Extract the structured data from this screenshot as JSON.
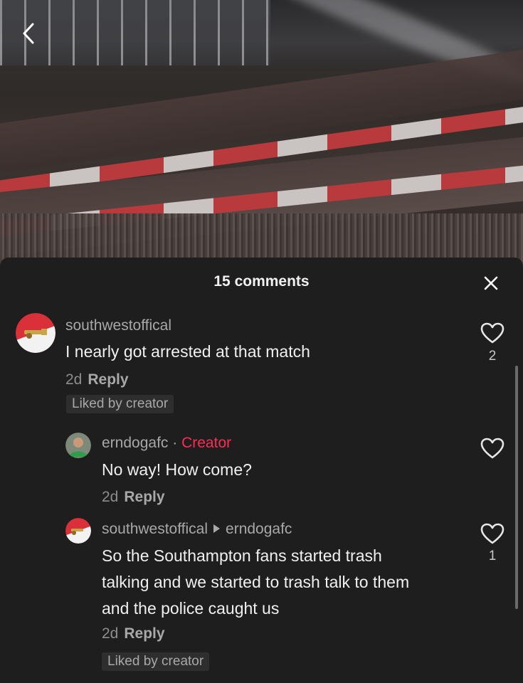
{
  "sheet": {
    "title": "15 comments"
  },
  "comments": [
    {
      "username": "southwestoffical",
      "text": "I nearly got arrested at that match",
      "time": "2d",
      "reply_label": "Reply",
      "badge": "Liked by creator",
      "likes": "2"
    },
    {
      "username": "erndogafc",
      "separator": "·",
      "creator_label": "Creator",
      "text": "No way! How come?",
      "time": "2d",
      "reply_label": "Reply"
    },
    {
      "username": "southwestoffical",
      "reply_to": "erndogafc",
      "text_lines": [
        "So the Southampton fans started trash",
        "talking and we started to trash talk to them",
        "and the police caught us"
      ],
      "time": "2d",
      "reply_label": "Reply",
      "badge": "Liked by creator",
      "likes": "1"
    }
  ],
  "colors": {
    "creator_accent": "#fe2c55",
    "sheet_bg": "#1e1e1e",
    "badge_bg": "#2e2e2e"
  },
  "icons": {
    "back": "chevron-left-icon",
    "close": "close-icon",
    "like": "heart-outline-icon"
  }
}
